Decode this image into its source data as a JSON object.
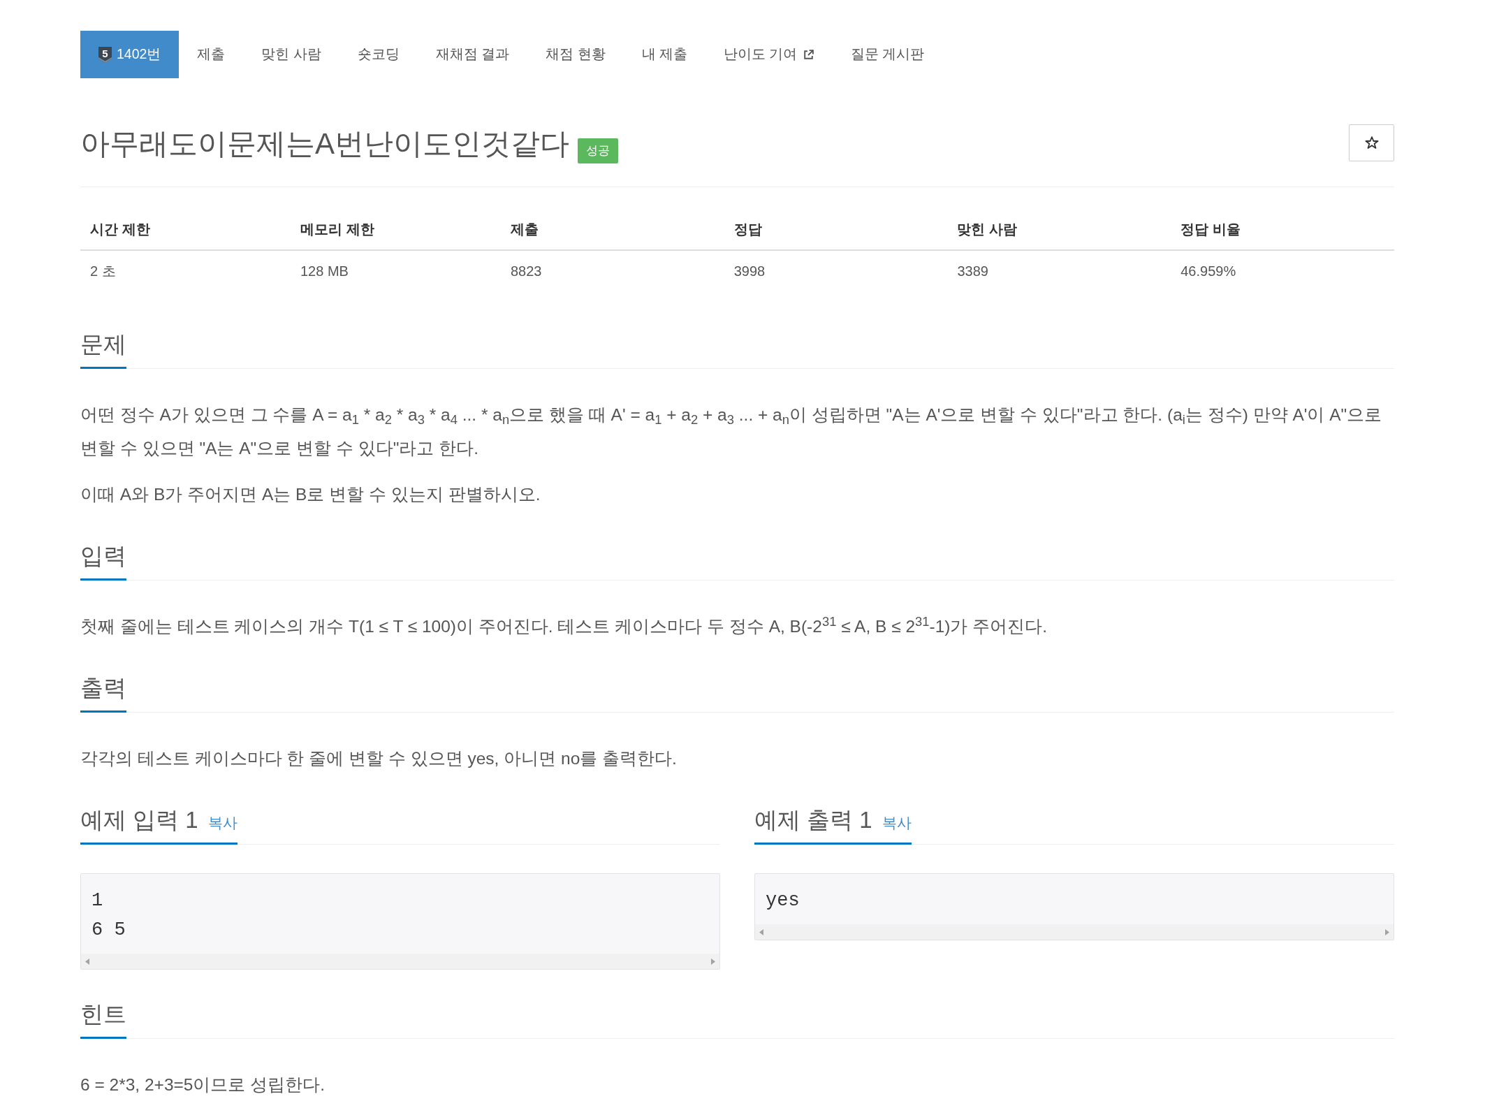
{
  "nav_tabs": [
    {
      "label": "1402번",
      "badge": "5",
      "selected": true,
      "external": false
    },
    {
      "label": "제출",
      "selected": false,
      "external": false
    },
    {
      "label": "맞힌 사람",
      "selected": false,
      "external": false
    },
    {
      "label": "숏코딩",
      "selected": false,
      "external": false
    },
    {
      "label": "재채점 결과",
      "selected": false,
      "external": false
    },
    {
      "label": "채점 현황",
      "selected": false,
      "external": false
    },
    {
      "label": "내 제출",
      "selected": false,
      "external": false
    },
    {
      "label": "난이도 기여",
      "selected": false,
      "external": true
    },
    {
      "label": "질문 게시판",
      "selected": false,
      "external": false
    }
  ],
  "problem": {
    "title": "아무래도이문제는A번난이도인것같다",
    "status_badge": "성공"
  },
  "info_table": {
    "columns": [
      "시간 제한",
      "메모리 제한",
      "제출",
      "정답",
      "맞힌 사람",
      "정답 비율"
    ],
    "rows": [
      [
        "2 초",
        "128 MB",
        "8823",
        "3998",
        "3389",
        "46.959%"
      ]
    ]
  },
  "sections": [
    {
      "kind": "text",
      "heading": "문제",
      "paragraphs": [
        "어떤 정수 A가 있으면 그 수를 A = a$_{1}$ * a$_{2}$ * a$_{3}$ * a$_{4}$ ... * a$_{n}$으로 했을 때 A' = a$_{1}$ + a$_{2}$ + a$_{3}$ ... + a$_{n}$이 성립하면 \"A는 A'으로 변할 수 있다\"라고 한다. (a$_{i}$는 정수) 만약 A'이 A\"으로 변할 수 있으면 \"A는 A\"으로 변할 수 있다\"라고 한다.",
        "이때 A와 B가 주어지면 A는 B로 변할 수 있는지 판별하시오."
      ]
    },
    {
      "kind": "text",
      "heading": "입력",
      "paragraphs": [
        "첫째 줄에는 테스트 케이스의 개수 T(1 ≤ T ≤ 100)이 주어진다. 테스트 케이스마다 두 정수 A, B(-2$^{31}$ ≤ A, B ≤ 2$^{31}$-1)가 주어진다."
      ]
    },
    {
      "kind": "text",
      "heading": "출력",
      "paragraphs": [
        "각각의 테스트 케이스마다 한 줄에 변할 수 있으면 yes, 아니면 no를 출력한다."
      ]
    },
    {
      "kind": "samples",
      "items": [
        {
          "heading": "예제 입력 1",
          "copy_link": "복사",
          "lines": [
            "1",
            "6 5"
          ]
        },
        {
          "heading": "예제 출력 1",
          "copy_link": "복사",
          "lines": [
            "yes"
          ]
        }
      ]
    },
    {
      "kind": "text",
      "heading": "힌트",
      "paragraphs": [
        "6 = 2*3, 2+3=5이므로 성립한다."
      ]
    }
  ]
}
